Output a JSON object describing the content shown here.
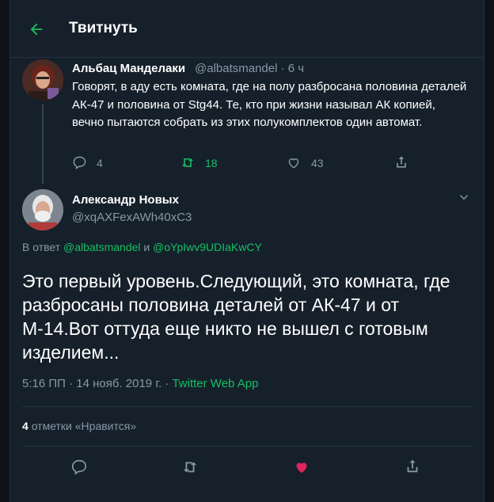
{
  "header": {
    "title": "Твитнуть",
    "back_icon": "arrow-left-icon",
    "accent": "#17bf63"
  },
  "parent_tweet": {
    "name": "Альбац Манделаки",
    "handle": "@albatsmandel",
    "sep": "·",
    "time": "6 ч",
    "text": "Говорят, в аду есть комната, где на полу разбросана половина деталей АК-47 и половина от Stg44. Те, кто при жизни называл АК копией, вечно пытаются собрать из этих полукомплектов один автомат.",
    "replies": "4",
    "retweets": "18",
    "likes": "43"
  },
  "main_tweet": {
    "name": "Александр Новых",
    "handle": "@xqAXFexAWh40xC3",
    "reply_prefix": "В ответ",
    "reply_user1": "@albatsmandel",
    "reply_and": "и",
    "reply_user2": "@oYpIwv9UDIaKwCY",
    "text": "Это первый уровень.Следующий, это комната, где разбросаны половина деталей от АК-47 и от М-14.Вот оттуда еще никто не вышел с готовым изделием...",
    "timestamp": "5:16 ПП · 14 нояб. 2019 г. ·",
    "source": "Twitter Web App",
    "like_count": "4",
    "like_label": "отметки «Нравится»",
    "liked_color": "#e0245e"
  }
}
